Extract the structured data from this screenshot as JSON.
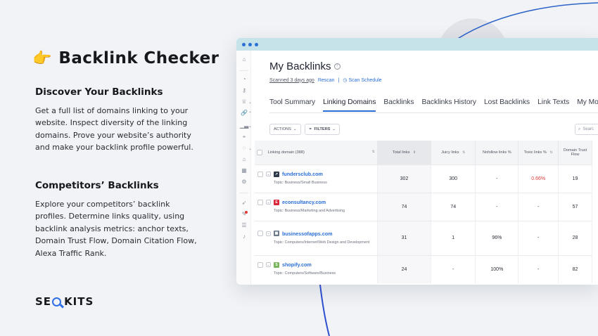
{
  "hero": {
    "icon": "pointing-hand-icon",
    "title": "Backlink Checker"
  },
  "sections": [
    {
      "heading": "Discover Your Backlinks",
      "text": "Get a full list of domains linking to your website. Inspect diversity of the linking domains. Prove your website’s authority and make your backlink profile powerful."
    },
    {
      "heading": "Competitors’ Backlinks",
      "text": "Explore your competitors’ backlink profiles. Determine links quality, using backlink analysis metrics: anchor texts, Domain Trust Flow, Domain Citation Flow, Alexa Traffic Rank."
    }
  ],
  "logo": {
    "left": "SE",
    "right": "KITS"
  },
  "app": {
    "page_title": "My Backlinks",
    "scanned": "Scanned 3 days ago",
    "rescan": "Rescan",
    "separator": "|",
    "scan_schedule": "Scan Schedule",
    "tabs": [
      "Tool Summary",
      "Linking Domains",
      "Backlinks",
      "Backlinks History",
      "Lost Backlinks",
      "Link Texts",
      "My Mos"
    ],
    "active_tab": "Linking Domains",
    "actions_label": "ACTIONS",
    "filters_label": "FILTERS",
    "search_placeholder": "Searc",
    "columns": [
      "Linking domain (388)",
      "Total links",
      "Juicy links",
      "Nofollow links %",
      "Toxic links %",
      "Domain Trust Flow"
    ],
    "rows": [
      {
        "domain": "fundersclub.com",
        "topic": "Topic: Business/Small Business",
        "total": "302",
        "juicy": "300",
        "nofollow": "-",
        "toxic": "0.66%",
        "dtf": "19",
        "fav_color": "#2e3a4a"
      },
      {
        "domain": "econsultancy.com",
        "topic": "Topic: Business/Marketing and Advertising",
        "total": "74",
        "juicy": "74",
        "nofollow": "-",
        "toxic": "-",
        "dtf": "57",
        "fav_color": "#d8263b"
      },
      {
        "domain": "businessofapps.com",
        "topic": "Topic: Computers/Internet/Web Design and Development",
        "total": "31",
        "juicy": "1",
        "nofollow": "96%",
        "toxic": "-",
        "dtf": "28",
        "fav_color": "#6c7a89"
      },
      {
        "domain": "shopify.com",
        "topic": "Topic: Computers/Software/Business",
        "total": "24",
        "juicy": "-",
        "nofollow": "100%",
        "toxic": "-",
        "dtf": "82",
        "fav_color": "#7ab55c"
      }
    ]
  },
  "colors": {
    "accent": "#2b6fd6",
    "titlebar": "#c5e3e8",
    "toxic_red": "#d83c3c"
  }
}
